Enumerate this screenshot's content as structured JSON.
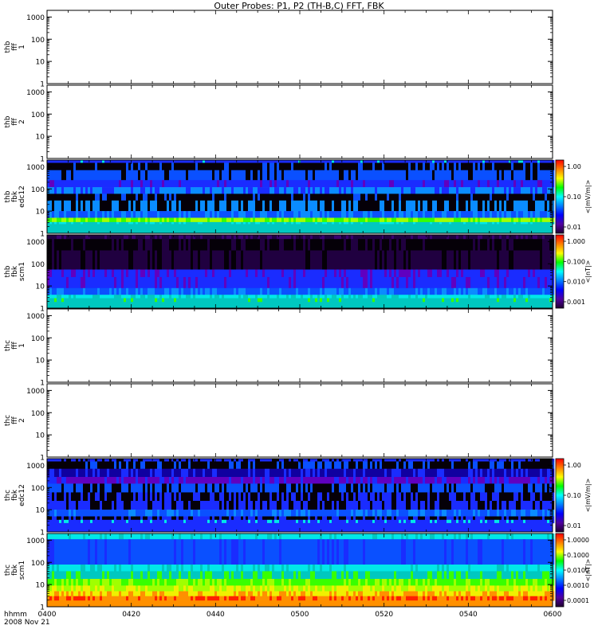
{
  "title": "Outer Probes: P1, P2 (TH-B,C) FFT, FBK",
  "time_axis": {
    "ticks": [
      "0400",
      "0420",
      "0440",
      "0500",
      "0520",
      "0540",
      "0600"
    ],
    "label_top": "hhmm",
    "label_bottom": "2008 Nov 21"
  },
  "freq_ticks": [
    "1",
    "10",
    "100",
    "1000"
  ],
  "panels": [
    {
      "ylabel": [
        "thb",
        "fff",
        "1"
      ],
      "filled": false,
      "colorbar": null
    },
    {
      "ylabel": [
        "thb",
        "fff",
        "2"
      ],
      "filled": false,
      "colorbar": null
    },
    {
      "ylabel": [
        "thb",
        "fbk",
        "edc12"
      ],
      "filled": true,
      "profile": "b_edc12",
      "colorbar": {
        "ticks": [
          "1.00",
          "0.10",
          "0.01"
        ],
        "unit": "<|mV/m|>"
      }
    },
    {
      "ylabel": [
        "thb",
        "fbk",
        "scm1"
      ],
      "filled": true,
      "profile": "b_scm1",
      "colorbar": {
        "ticks": [
          "1.000",
          "0.100",
          "0.010",
          "0.001"
        ],
        "unit": "<|nT|>"
      }
    },
    {
      "ylabel": [
        "thc",
        "fff",
        "1"
      ],
      "filled": false,
      "colorbar": null
    },
    {
      "ylabel": [
        "thc",
        "fff",
        "2"
      ],
      "filled": false,
      "colorbar": null
    },
    {
      "ylabel": [
        "thc",
        "fbk",
        "edc12"
      ],
      "filled": true,
      "profile": "c_edc12",
      "colorbar": {
        "ticks": [
          "1.00",
          "0.10",
          "0.01"
        ],
        "unit": "<|mV/m|>"
      }
    },
    {
      "ylabel": [
        "thc",
        "fbk",
        "scm1"
      ],
      "filled": true,
      "profile": "c_scm1",
      "colorbar": {
        "ticks": [
          "1.0000",
          "0.1000",
          "0.0100",
          "0.0010",
          "0.0001"
        ],
        "unit": "<|nT|>"
      }
    }
  ],
  "chart_data": {
    "type": "heatmap",
    "title": "Outer Probes: P1, P2 (TH-B,C) FFT, FBK",
    "x_range": [
      "0400",
      "0600"
    ],
    "y_scale": "log",
    "y_range": [
      1,
      1000
    ],
    "panels": [
      {
        "name": "thb fff 1",
        "data": "empty"
      },
      {
        "name": "thb fff 2",
        "data": "empty"
      },
      {
        "name": "thb fbk edc12",
        "unit": "<|mV/m|>",
        "color_range": [
          0.01,
          1.0
        ],
        "bands_dominant_level": [
          "green-yellow",
          "blue-black mixed",
          "blue",
          "blue-cyan",
          "black",
          "blue",
          "black",
          "blue"
        ]
      },
      {
        "name": "thb fbk scm1",
        "unit": "<|nT|>",
        "color_range": [
          0.001,
          1.0
        ],
        "bands_dominant_level": [
          "cyan",
          "blue",
          "blue-purple",
          "purple",
          "black",
          "black",
          "black",
          "purple"
        ]
      },
      {
        "name": "thc fff 1",
        "data": "empty"
      },
      {
        "name": "thc fff 2",
        "data": "empty"
      },
      {
        "name": "thc fbk edc12",
        "unit": "<|mV/m|>",
        "color_range": [
          0.01,
          1.0
        ],
        "bands_dominant_level": [
          "blue",
          "blue-black mixed",
          "blue-black mixed",
          "blue-black mixed",
          "purple-blue",
          "black",
          "black",
          "blue"
        ]
      },
      {
        "name": "thc fbk scm1",
        "unit": "<|nT|>",
        "color_range": [
          0.0001,
          1.0
        ],
        "bands_dominant_level": [
          "red-orange",
          "yellow-green",
          "green",
          "green-cyan",
          "cyan",
          "blue",
          "blue",
          "cyan"
        ]
      }
    ]
  }
}
